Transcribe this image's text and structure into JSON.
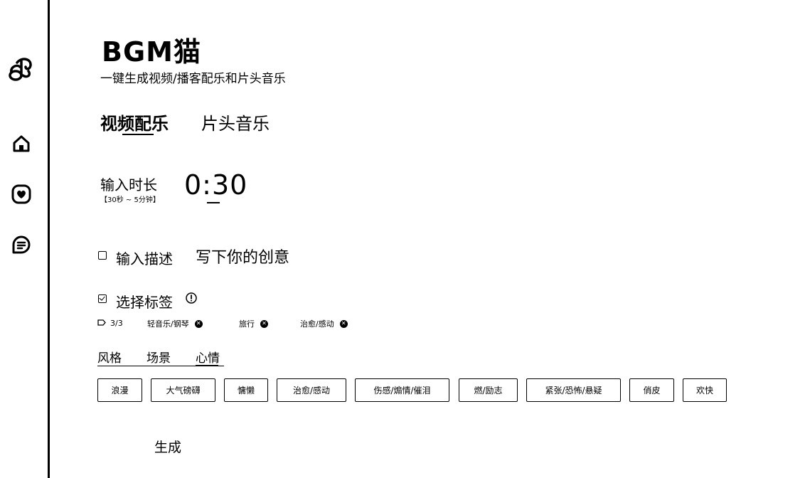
{
  "app": {
    "title": "BGM猫",
    "subtitle": "一键生成视频/播客配乐和片头音乐"
  },
  "sidebar": {
    "logo": "music-note-logo",
    "items": [
      {
        "icon": "home-icon"
      },
      {
        "icon": "heart-icon"
      },
      {
        "icon": "chat-icon"
      }
    ]
  },
  "mode_tabs": [
    {
      "label": "视频配乐",
      "active": true
    },
    {
      "label": "片头音乐",
      "active": false
    }
  ],
  "duration": {
    "label": "输入时长",
    "hint": "【30秒 ~ 5分钟】",
    "value": "0:30"
  },
  "description": {
    "label": "输入描述",
    "placeholder": "写下你的创意",
    "checked": false
  },
  "tags": {
    "label": "选择标签",
    "checked": true,
    "count": "3/3",
    "selected": [
      "轻音乐/钢琴",
      "旅行",
      "治愈/感动"
    ]
  },
  "categories": [
    {
      "label": "风格",
      "active": false
    },
    {
      "label": "场景",
      "active": false
    },
    {
      "label": "心情",
      "active": true
    }
  ],
  "mood_tags": [
    "浪漫",
    "大气磅礴",
    "慵懒",
    "治愈/感动",
    "伤感/煽情/催泪",
    "燃/励志",
    "紧张/恐怖/悬疑",
    "俏皮",
    "欢快"
  ],
  "actions": {
    "generate_label": "生成"
  },
  "colors": {
    "foreground": "#000000",
    "background": "#ffffff"
  }
}
